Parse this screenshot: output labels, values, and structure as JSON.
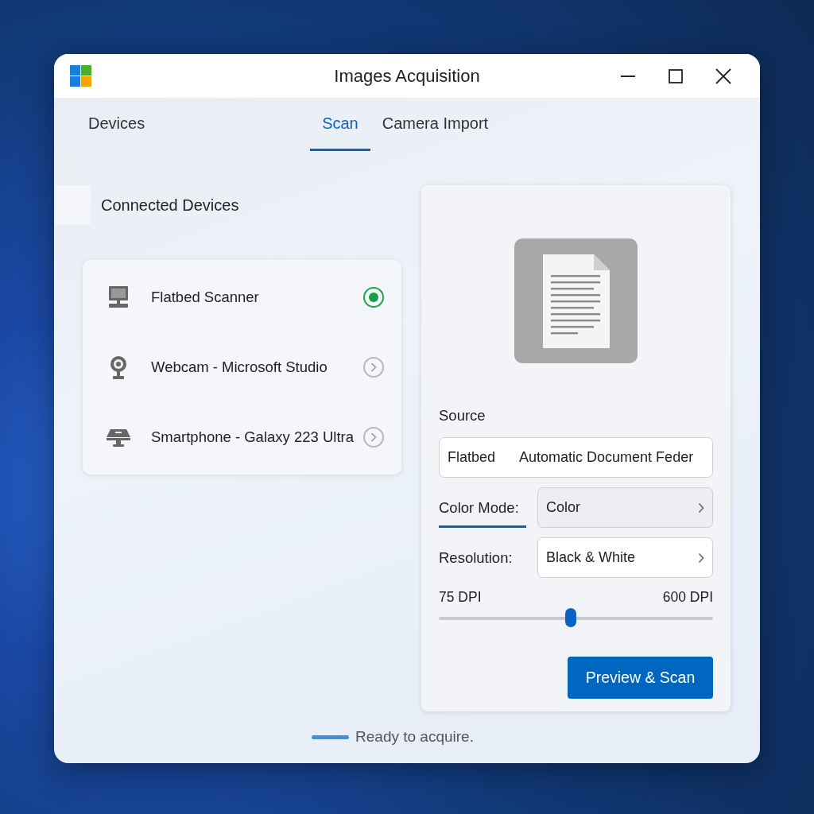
{
  "window": {
    "title": "Images Acquisition"
  },
  "tabs": [
    {
      "label": "Devices",
      "selected": false
    },
    {
      "label": "Scan",
      "selected": true
    },
    {
      "label": "Camera Import",
      "selected": false
    }
  ],
  "devices_header": "Connected Devices",
  "devices": [
    {
      "name": "Flatbed Scanner",
      "kind": "monitor",
      "selected": true
    },
    {
      "name": "Webcam - Microsoft Studio",
      "kind": "webcam",
      "selected": false
    },
    {
      "name": "Smartphone - Galaxy 223 Ultra",
      "kind": "scanner",
      "selected": false
    }
  ],
  "source": {
    "label": "Source",
    "options": [
      "Flatbed",
      "Automatic Document Feder"
    ]
  },
  "settings": [
    {
      "label": "Color Mode:",
      "value": "Color",
      "active": true
    },
    {
      "label": "Resolution:",
      "value": "Black & White",
      "active": false
    }
  ],
  "slider": {
    "min_label": "75 DPI",
    "max_label": "600 DPI",
    "level": 0.48
  },
  "action_button": "Preview & Scan",
  "status": "Ready to acquire."
}
